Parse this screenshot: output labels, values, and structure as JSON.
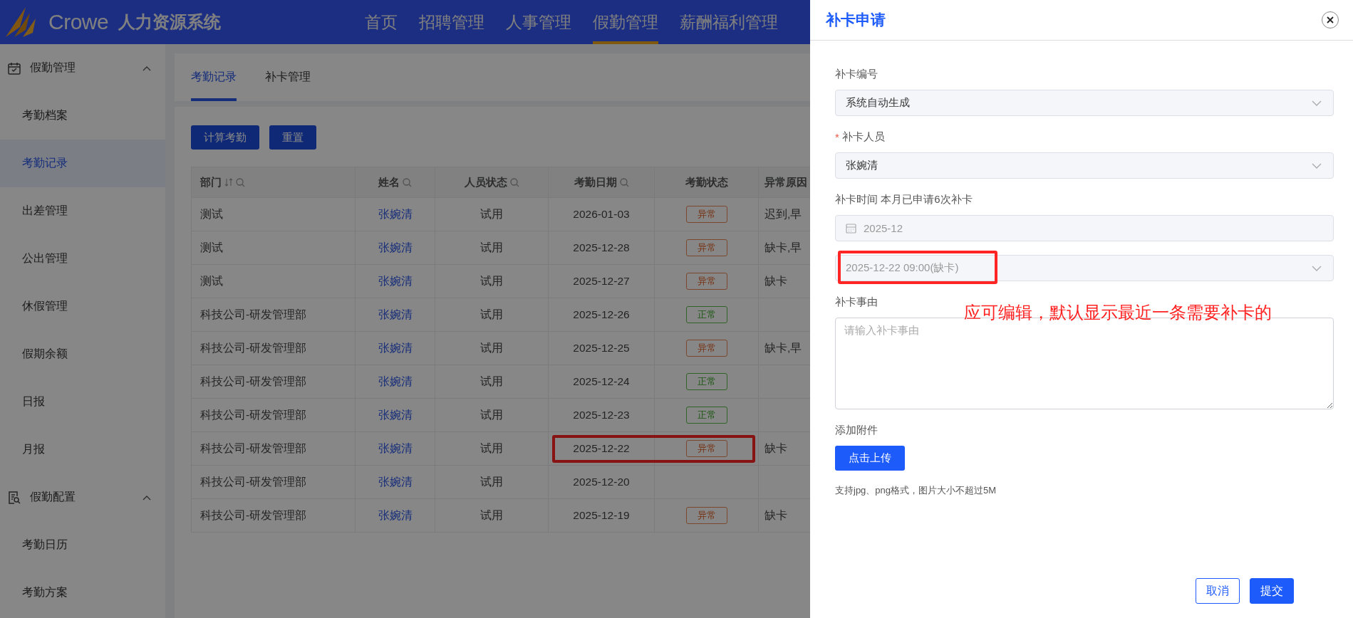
{
  "header": {
    "logo_text": "Crowe",
    "system_name": "人力资源系统",
    "nav": [
      {
        "label": "首页",
        "selected": false
      },
      {
        "label": "招聘管理",
        "selected": false
      },
      {
        "label": "人事管理",
        "selected": false
      },
      {
        "label": "假勤管理",
        "selected": true
      },
      {
        "label": "薪酬福利管理",
        "selected": false
      }
    ]
  },
  "sidebar": {
    "groups": [
      {
        "label": "假勤管理",
        "kind": "calendar",
        "expanded": true,
        "items": [
          {
            "label": "考勤档案",
            "selected": false
          },
          {
            "label": "考勤记录",
            "selected": true
          },
          {
            "label": "出差管理",
            "selected": false
          },
          {
            "label": "公出管理",
            "selected": false
          },
          {
            "label": "休假管理",
            "selected": false
          },
          {
            "label": "假期余额",
            "selected": false
          },
          {
            "label": "日报",
            "selected": false
          },
          {
            "label": "月报",
            "selected": false
          }
        ]
      },
      {
        "label": "假勤配置",
        "kind": "document",
        "expanded": true,
        "items": [
          {
            "label": "考勤日历",
            "selected": false
          },
          {
            "label": "考勤方案",
            "selected": false
          }
        ]
      }
    ]
  },
  "tabs": [
    {
      "label": "考勤记录",
      "selected": true
    },
    {
      "label": "补卡管理",
      "selected": false
    }
  ],
  "buttons": [
    "计算考勤",
    "重置"
  ],
  "table": {
    "columns": [
      {
        "label": "部门",
        "sortable": true,
        "searchable": true
      },
      {
        "label": "姓名",
        "sortable": false,
        "searchable": true
      },
      {
        "label": "人员状态",
        "sortable": false,
        "searchable": true
      },
      {
        "label": "考勤日期",
        "sortable": false,
        "searchable": true
      },
      {
        "label": "考勤状态",
        "sortable": false,
        "searchable": false
      },
      {
        "label": "异常原因"
      }
    ],
    "rows": [
      {
        "department": "测试",
        "name": "张婉清",
        "person_status": "试用",
        "date": "2026-01-03",
        "status": {
          "label": "异常",
          "kind": "abnormal"
        },
        "reason": "迟到,早",
        "highlighted": false
      },
      {
        "department": "测试",
        "name": "张婉清",
        "person_status": "试用",
        "date": "2025-12-28",
        "status": {
          "label": "异常",
          "kind": "abnormal"
        },
        "reason": "缺卡,早",
        "highlighted": false
      },
      {
        "department": "测试",
        "name": "张婉清",
        "person_status": "试用",
        "date": "2025-12-27",
        "status": {
          "label": "异常",
          "kind": "abnormal"
        },
        "reason": "缺卡",
        "highlighted": false
      },
      {
        "department": "科技公司-研发管理部",
        "name": "张婉清",
        "person_status": "试用",
        "date": "2025-12-26",
        "status": {
          "label": "正常",
          "kind": "normal"
        },
        "highlighted": false
      },
      {
        "department": "科技公司-研发管理部",
        "name": "张婉清",
        "person_status": "试用",
        "date": "2025-12-25",
        "status": {
          "label": "异常",
          "kind": "abnormal"
        },
        "reason": "缺卡,早",
        "highlighted": false
      },
      {
        "department": "科技公司-研发管理部",
        "name": "张婉清",
        "person_status": "试用",
        "date": "2025-12-24",
        "status": {
          "label": "正常",
          "kind": "normal"
        },
        "highlighted": false
      },
      {
        "department": "科技公司-研发管理部",
        "name": "张婉清",
        "person_status": "试用",
        "date": "2025-12-23",
        "status": {
          "label": "正常",
          "kind": "normal"
        },
        "highlighted": false
      },
      {
        "department": "科技公司-研发管理部",
        "name": "张婉清",
        "person_status": "试用",
        "date": "2025-12-22",
        "status": {
          "label": "异常",
          "kind": "abnormal"
        },
        "reason": "缺卡",
        "highlighted": true
      },
      {
        "department": "科技公司-研发管理部",
        "name": "张婉清",
        "person_status": "试用",
        "date": "2025-12-20",
        "highlighted": false
      },
      {
        "department": "科技公司-研发管理部",
        "name": "张婉清",
        "person_status": "试用",
        "date": "2025-12-19",
        "status": {
          "label": "异常",
          "kind": "abnormal"
        },
        "reason": "缺卡",
        "highlighted": false
      }
    ]
  },
  "drawer": {
    "title": "补卡申请",
    "fields": [
      {
        "kind": "select",
        "label": "补卡编号",
        "value": "系统自动生成",
        "disabled": false,
        "highlighted": false
      },
      {
        "kind": "select",
        "label": "补卡人员",
        "required_mark": "*",
        "value": "张婉清",
        "disabled": false,
        "highlighted": false
      },
      {
        "kind": "date",
        "label": "补卡时间 本月已申请6次补卡",
        "value": "2025-12",
        "disabled": true,
        "highlighted": false
      },
      {
        "kind": "select",
        "value": "2025-12-22 09:00(缺卡)",
        "disabled": true,
        "highlighted": true
      },
      {
        "kind": "textarea",
        "label": "补卡事由",
        "placeholder": "请输入补卡事由",
        "highlighted": false
      },
      {
        "kind": "upload",
        "label": "添加附件",
        "button": "点击上传",
        "hint": "支持jpg、png格式，图片大小不超过5M",
        "highlighted": false
      }
    ],
    "annotation": "应可编辑，默认显示最近一条需要补卡的",
    "buttons": [
      {
        "label": "取消",
        "kind": "secondary"
      },
      {
        "label": "提交",
        "kind": "primary"
      }
    ]
  }
}
